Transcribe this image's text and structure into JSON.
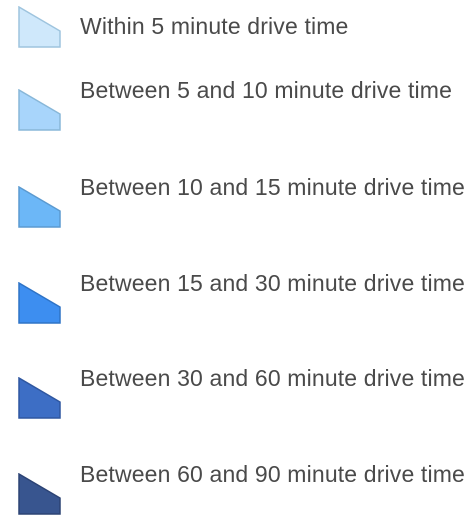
{
  "legend": {
    "items": [
      {
        "label": "Within 5 minute drive time",
        "fill": "#cfe8fb",
        "stroke": "#9ec4de",
        "icon": "polygon-swatch-icon"
      },
      {
        "label": "Between 5 and 10 minute drive time",
        "fill": "#a8d5fb",
        "stroke": "#88b7d8",
        "icon": "polygon-swatch-icon"
      },
      {
        "label": "Between 10 and 15 minute drive time",
        "fill": "#6cb7f7",
        "stroke": "#5b9ad0",
        "icon": "polygon-swatch-icon"
      },
      {
        "label": "Between 15 and 30 minute drive time",
        "fill": "#3d8ef0",
        "stroke": "#2e73c6",
        "icon": "polygon-swatch-icon"
      },
      {
        "label": "Between 30 and 60 minute drive time",
        "fill": "#3d6ec5",
        "stroke": "#2f57a0",
        "icon": "polygon-swatch-icon"
      },
      {
        "label": "Between 60 and 90 minute drive time",
        "fill": "#38558f",
        "stroke": "#2c4374",
        "icon": "polygon-swatch-icon"
      }
    ]
  }
}
